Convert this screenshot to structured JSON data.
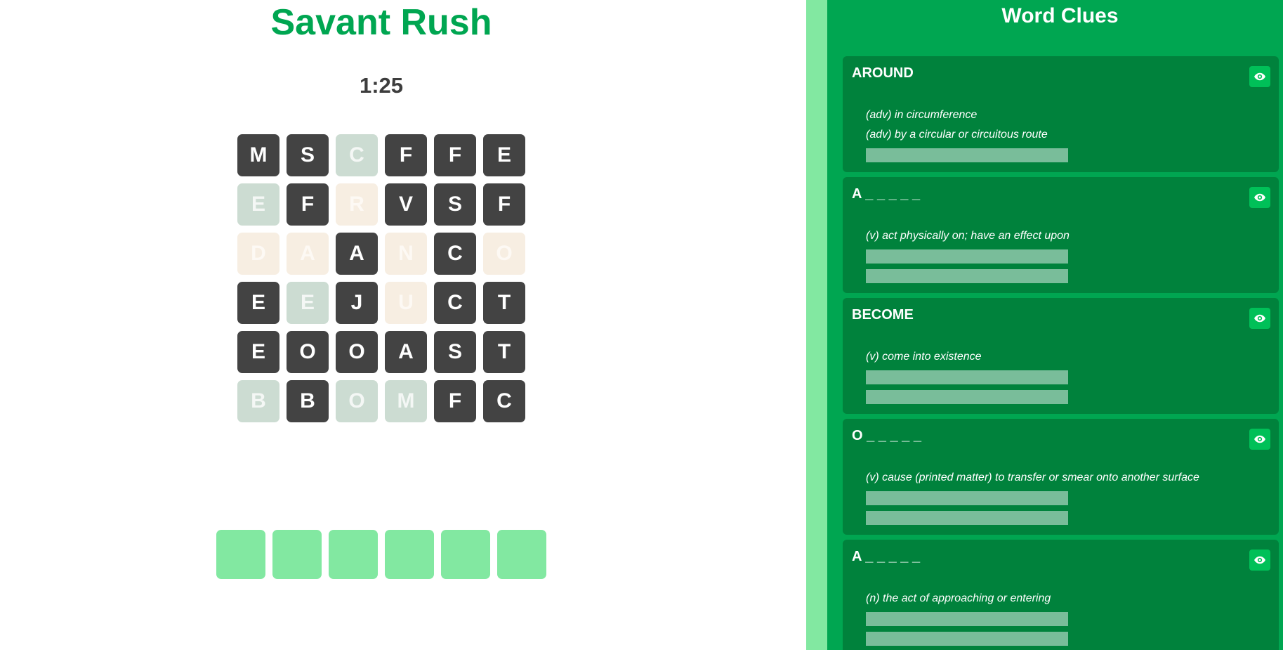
{
  "game": {
    "title": "Savant Rush",
    "timer": "1:25",
    "grid": [
      [
        {
          "letter": "M",
          "state": "dark"
        },
        {
          "letter": "S",
          "state": "dark"
        },
        {
          "letter": "C",
          "state": "green"
        },
        {
          "letter": "F",
          "state": "dark"
        },
        {
          "letter": "F",
          "state": "dark"
        },
        {
          "letter": "E",
          "state": "dark"
        }
      ],
      [
        {
          "letter": "E",
          "state": "green"
        },
        {
          "letter": "F",
          "state": "dark"
        },
        {
          "letter": "R",
          "state": "beige"
        },
        {
          "letter": "V",
          "state": "dark"
        },
        {
          "letter": "S",
          "state": "dark"
        },
        {
          "letter": "F",
          "state": "dark"
        }
      ],
      [
        {
          "letter": "D",
          "state": "beige"
        },
        {
          "letter": "A",
          "state": "beige"
        },
        {
          "letter": "A",
          "state": "dark"
        },
        {
          "letter": "N",
          "state": "beige"
        },
        {
          "letter": "C",
          "state": "dark"
        },
        {
          "letter": "O",
          "state": "beige"
        }
      ],
      [
        {
          "letter": "E",
          "state": "dark"
        },
        {
          "letter": "E",
          "state": "green"
        },
        {
          "letter": "J",
          "state": "dark"
        },
        {
          "letter": "U",
          "state": "beige"
        },
        {
          "letter": "C",
          "state": "dark"
        },
        {
          "letter": "T",
          "state": "dark"
        }
      ],
      [
        {
          "letter": "E",
          "state": "dark"
        },
        {
          "letter": "O",
          "state": "dark"
        },
        {
          "letter": "O",
          "state": "dark"
        },
        {
          "letter": "A",
          "state": "dark"
        },
        {
          "letter": "S",
          "state": "dark"
        },
        {
          "letter": "T",
          "state": "dark"
        }
      ],
      [
        {
          "letter": "B",
          "state": "green"
        },
        {
          "letter": "B",
          "state": "dark"
        },
        {
          "letter": "O",
          "state": "green"
        },
        {
          "letter": "M",
          "state": "green"
        },
        {
          "letter": "F",
          "state": "dark"
        },
        {
          "letter": "C",
          "state": "dark"
        }
      ]
    ],
    "answer_slots": [
      "",
      "",
      "",
      "",
      "",
      ""
    ]
  },
  "clues": {
    "title": "Word Clues",
    "items": [
      {
        "word": "AROUND",
        "definitions": [
          "(adv) in circumference",
          "(adv) by a circular or circuitous route"
        ],
        "hint_bars": 1
      },
      {
        "word": "A _ _ _ _ _",
        "definitions": [
          "(v) act physically on; have an effect upon"
        ],
        "hint_bars": 2
      },
      {
        "word": "BECOME",
        "definitions": [
          "(v) come into existence"
        ],
        "hint_bars": 2
      },
      {
        "word": "O _ _ _ _ _",
        "definitions": [
          "(v) cause (printed matter) to transfer or smear onto another surface"
        ],
        "hint_bars": 2
      },
      {
        "word": "A _ _ _ _ _",
        "definitions": [
          "(n) the act of approaching or entering"
        ],
        "hint_bars": 2
      }
    ]
  },
  "colors": {
    "accent": "#00a651",
    "panel": "#00a651",
    "card": "#00823c",
    "tile_dark": "#434343",
    "tile_green": "#ccdcd2",
    "tile_beige": "#f7eee2",
    "slot": "#82e8a1",
    "hint_bar": "#79bd9a",
    "eye_button": "#00c058"
  },
  "icons": {
    "reveal": "eye-icon"
  }
}
